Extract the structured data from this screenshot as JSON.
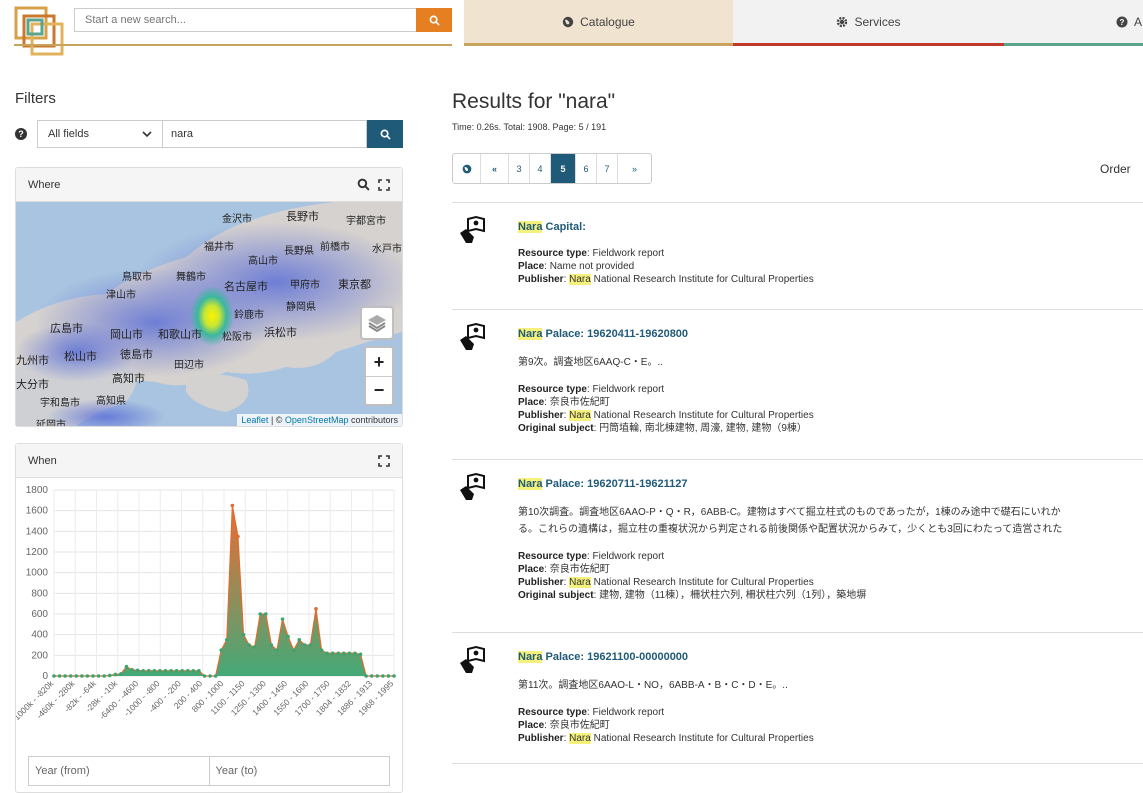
{
  "header": {
    "search_placeholder": "Start a new search...",
    "nav": [
      {
        "label": "Catalogue",
        "icon": "globe-icon"
      },
      {
        "label": "Services",
        "icon": "gear-icon"
      },
      {
        "label": "A",
        "icon": "question-circle-icon"
      }
    ]
  },
  "filters": {
    "title": "Filters",
    "field_select": "All fields",
    "field_value": "nara",
    "where_title": "Where",
    "when_title": "When",
    "map_labels": [
      "金沢市",
      "長野市",
      "宇都宮市",
      "福井市",
      "高山市",
      "前橋市",
      "水戸市",
      "長野県",
      "鳥取市",
      "舞鶴市",
      "甲府市",
      "東京都",
      "津山市",
      "名古屋市",
      "静岡県",
      "広島市",
      "岡山市",
      "和歌山市",
      "松阪市",
      "浜松市",
      "鈴鹿市",
      "九州市",
      "松山市",
      "徳島市",
      "田辺市",
      "高知市",
      "大分市",
      "宇和島市",
      "高知県",
      "延岡市"
    ],
    "attribution_leaflet": "Leaflet",
    "attribution_sep": " | © ",
    "attribution_osm": "OpenStreetMap",
    "attribution_tail": " contributors",
    "year_from": "Year (from)",
    "year_to": "Year (to)"
  },
  "chart_data": {
    "type": "area",
    "title": "",
    "xlabel": "",
    "ylabel": "",
    "ylim": [
      0,
      1800
    ],
    "yticks": [
      0,
      200,
      400,
      600,
      800,
      1000,
      1200,
      1400,
      1600,
      1800
    ],
    "xtick_labels": [
      "-1000k - -820k",
      "-460k - -280k",
      "-82k - -64k",
      "-28k - -10k",
      "-6400 - -4600",
      "-1000 - -800",
      "-400 - -200",
      "200 - 400",
      "800 - 1000",
      "1100 - 1150",
      "1250 - 1300",
      "1400 - 1450",
      "1550 - 1600",
      "1700 - 1750",
      "1804 - 1832",
      "1886 - 1913",
      "1968 - 1995"
    ],
    "values": [
      0,
      0,
      0,
      0,
      0,
      0,
      0,
      0,
      0,
      0,
      5,
      15,
      20,
      90,
      60,
      55,
      50,
      50,
      50,
      50,
      50,
      50,
      50,
      50,
      50,
      50,
      50,
      0,
      0,
      0,
      250,
      350,
      1650,
      1350,
      400,
      300,
      280,
      600,
      600,
      300,
      250,
      550,
      380,
      250,
      350,
      300,
      300,
      650,
      250,
      220,
      220,
      220,
      220,
      220,
      220,
      210,
      0,
      0,
      0,
      0,
      0,
      0
    ],
    "grid": true,
    "colors": {
      "low": "#3aa571",
      "high": "#e8652a",
      "line": "#e26b2e",
      "point": "#3aa571"
    }
  },
  "results": {
    "title": "Results for \"nara\"",
    "meta": "Time: 0.26s. Total: 1908. Page: 5 / 191",
    "pager": [
      "«",
      "3",
      "4",
      "5",
      "6",
      "7",
      "»"
    ],
    "active_page": "5",
    "order_label": "Order",
    "items": [
      {
        "title_hl": "Nara",
        "title_rest": " Capital:",
        "desc": "",
        "resource_type": "Fieldwork report",
        "place": "Name not provided",
        "publisher_hl": "Nara",
        "publisher_rest": " National Research Institute for Cultural Properties",
        "original_subject": ""
      },
      {
        "title_hl": "Nara",
        "title_rest": " Palace: 19620411-19620800",
        "desc": "第9次。調査地区6AAQ-C・E。..",
        "resource_type": "Fieldwork report",
        "place": "奈良市佐紀町",
        "publisher_hl": "Nara",
        "publisher_rest": " National Research Institute for Cultural Properties",
        "original_subject": "円筒埴輪, 南北棟建物, 周濠, 建物, 建物（9棟）"
      },
      {
        "title_hl": "Nara",
        "title_rest": " Palace: 19620711-19621127",
        "desc": "第10次調査。調査地区6AAO-P・Q・R，6ABB-C。建物はすべて掘立柱式のものであったが，1棟のみ途中で礎石にいれか",
        "desc2": "る。これらの遺構は，掘立柱の重複状況から判定される前後関係や配置状況からみて，少くとも3回にわたって造営された",
        "resource_type": "Fieldwork report",
        "place": "奈良市佐紀町",
        "publisher_hl": "Nara",
        "publisher_rest": " National Research Institute for Cultural Properties",
        "original_subject": "建物, 建物（11棟），柵状柱穴列, 柵状柱穴列（1列），築地塀"
      },
      {
        "title_hl": "Nara",
        "title_rest": " Palace: 19621100-00000000",
        "desc": "第11次。調査地区6AAO-L・NO，6ABB-A・B・C・D・E。..",
        "resource_type": "Fieldwork report",
        "place": "奈良市佐紀町",
        "publisher_hl": "Nara",
        "publisher_rest": " National Research Institute for Cultural Properties",
        "original_subject": ""
      }
    ],
    "labels": {
      "resource_type": "Resource type",
      "place": "Place",
      "publisher": "Publisher",
      "original_subject": "Original subject"
    }
  }
}
